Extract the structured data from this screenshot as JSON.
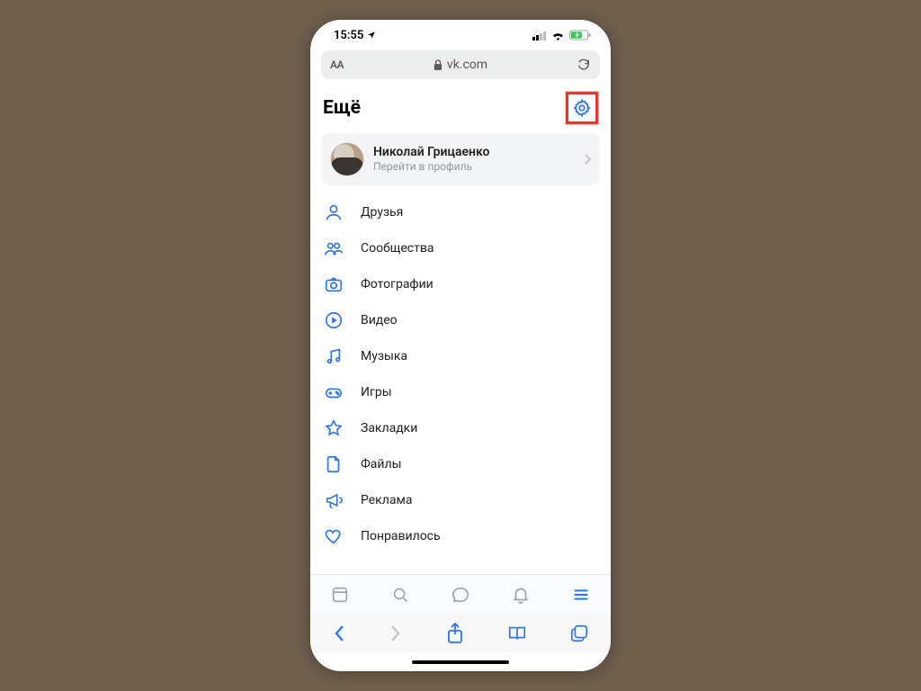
{
  "status": {
    "time": "15:55"
  },
  "url": {
    "domain": "vk.com",
    "aa": "AA"
  },
  "header": {
    "title": "Ещё"
  },
  "profile": {
    "name": "Николай Грицаенко",
    "subtitle": "Перейти в профиль"
  },
  "menu": [
    {
      "label": "Друзья"
    },
    {
      "label": "Сообщества"
    },
    {
      "label": "Фотографии"
    },
    {
      "label": "Видео"
    },
    {
      "label": "Музыка"
    },
    {
      "label": "Игры"
    },
    {
      "label": "Закладки"
    },
    {
      "label": "Файлы"
    },
    {
      "label": "Реклама"
    },
    {
      "label": "Понравилось"
    }
  ]
}
